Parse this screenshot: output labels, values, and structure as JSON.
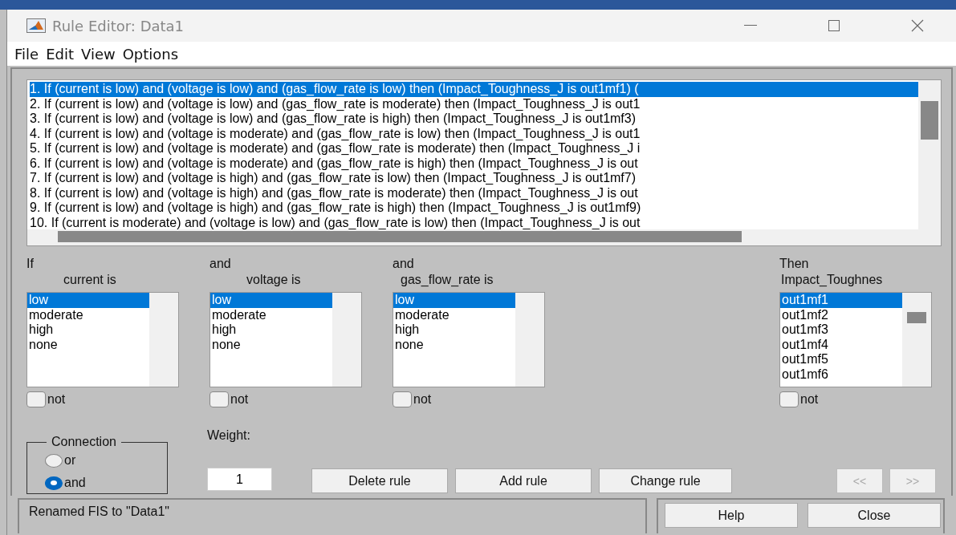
{
  "window": {
    "title": "Rule Editor: Data1"
  },
  "menu": [
    "File",
    "Edit",
    "View",
    "Options"
  ],
  "rules": [
    {
      "text": "1. If (current is low) and (voltage is low) and (gas_flow_rate is low) then (Impact_Toughness_J is out1mf1) (",
      "selected": true
    },
    {
      "text": "2. If (current is low) and (voltage is low) and (gas_flow_rate is moderate) then (Impact_Toughness_J is out1",
      "selected": false
    },
    {
      "text": "3. If (current is low) and (voltage is low) and (gas_flow_rate is high) then (Impact_Toughness_J is out1mf3)",
      "selected": false
    },
    {
      "text": "4. If (current is low) and (voltage is moderate) and (gas_flow_rate is low) then (Impact_Toughness_J is out1",
      "selected": false
    },
    {
      "text": "5. If (current is low) and (voltage is moderate) and (gas_flow_rate is moderate) then (Impact_Toughness_J i",
      "selected": false
    },
    {
      "text": "6. If (current is low) and (voltage is moderate) and (gas_flow_rate is high) then (Impact_Toughness_J is out",
      "selected": false
    },
    {
      "text": "7. If (current is low) and (voltage is high) and (gas_flow_rate is low) then (Impact_Toughness_J is out1mf7)",
      "selected": false
    },
    {
      "text": "8. If (current is low) and (voltage is high) and (gas_flow_rate is moderate) then (Impact_Toughness_J is out",
      "selected": false
    },
    {
      "text": "9. If (current is low) and (voltage is high) and (gas_flow_rate is high) then (Impact_Toughness_J is out1mf9)",
      "selected": false
    },
    {
      "text": "10. If (current is moderate) and (voltage is low) and (gas_flow_rate is low) then (Impact_Toughness_J is out",
      "selected": false
    }
  ],
  "variables": [
    {
      "prefix": "If",
      "name": "current is",
      "kind": "input",
      "not_label": "not",
      "not_checked": false,
      "items": [
        {
          "label": "low",
          "selected": true
        },
        {
          "label": "moderate",
          "selected": false
        },
        {
          "label": "high",
          "selected": false
        },
        {
          "label": "none",
          "selected": false
        }
      ]
    },
    {
      "prefix": "and",
      "name": "voltage is",
      "kind": "input",
      "not_label": "not",
      "not_checked": false,
      "items": [
        {
          "label": "low",
          "selected": true
        },
        {
          "label": "moderate",
          "selected": false
        },
        {
          "label": "high",
          "selected": false
        },
        {
          "label": "none",
          "selected": false
        }
      ]
    },
    {
      "prefix": "and",
      "name": "gas_flow_rate is",
      "kind": "input",
      "not_label": "not",
      "not_checked": false,
      "items": [
        {
          "label": "low",
          "selected": true
        },
        {
          "label": "moderate",
          "selected": false
        },
        {
          "label": "high",
          "selected": false
        },
        {
          "label": "none",
          "selected": false
        }
      ]
    },
    {
      "prefix": "Then",
      "name": "Impact_Toughnes",
      "kind": "output",
      "not_label": "not",
      "not_checked": false,
      "items": [
        {
          "label": "out1mf1",
          "selected": true
        },
        {
          "label": "out1mf2",
          "selected": false
        },
        {
          "label": "out1mf3",
          "selected": false
        },
        {
          "label": "out1mf4",
          "selected": false
        },
        {
          "label": "out1mf5",
          "selected": false
        },
        {
          "label": "out1mf6",
          "selected": false
        }
      ]
    }
  ],
  "connection": {
    "title": "Connection",
    "options": [
      {
        "label": "or",
        "selected": false
      },
      {
        "label": "and",
        "selected": true
      }
    ]
  },
  "weight": {
    "label": "Weight:",
    "value": "1"
  },
  "rule_buttons": [
    "Delete rule",
    "Add rule",
    "Change rule"
  ],
  "nav_buttons": [
    {
      "label": "<<",
      "disabled": true
    },
    {
      "label": ">>",
      "disabled": true
    }
  ],
  "status": "Renamed FIS to \"Data1\"",
  "footer_buttons": [
    "Help",
    "Close"
  ]
}
